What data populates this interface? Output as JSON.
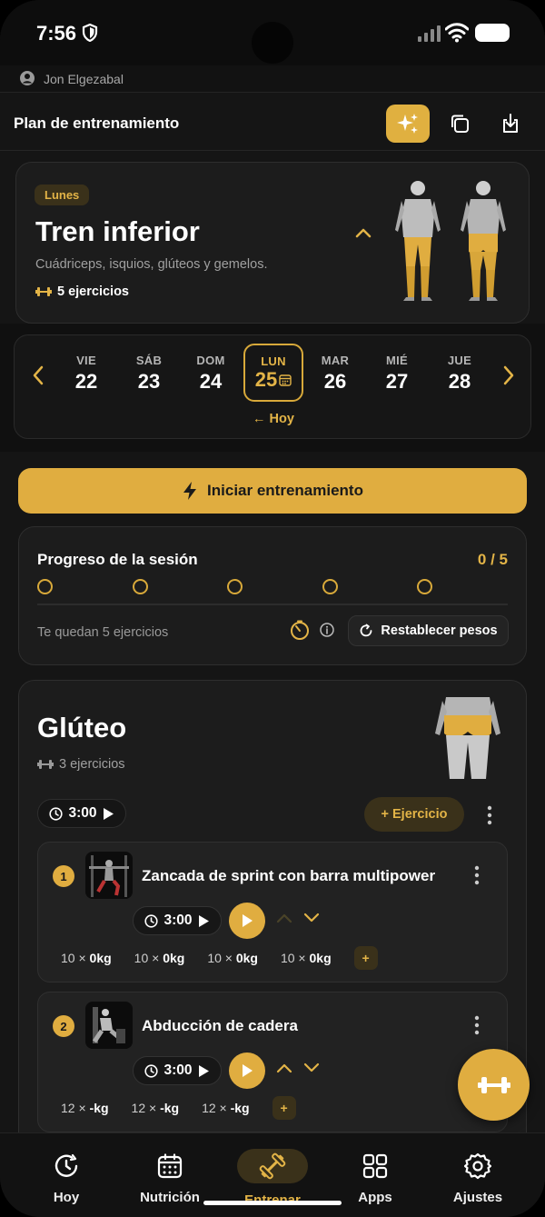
{
  "status": {
    "time": "7:56"
  },
  "user": {
    "name": "Jon Elgezabal"
  },
  "header": {
    "title": "Plan de entrenamiento"
  },
  "day_card": {
    "pill": "Lunes",
    "title": "Tren inferior",
    "subtitle": "Cuádriceps, isquios, glúteos y gemelos.",
    "exercise_count": "5 ejercicios"
  },
  "week": {
    "days": [
      {
        "name": "VIE",
        "date": "22"
      },
      {
        "name": "SÁB",
        "date": "23"
      },
      {
        "name": "DOM",
        "date": "24"
      },
      {
        "name": "LUN",
        "date": "25"
      },
      {
        "name": "MAR",
        "date": "26"
      },
      {
        "name": "MIÉ",
        "date": "27"
      },
      {
        "name": "JUE",
        "date": "28"
      }
    ],
    "today_label": "← Hoy"
  },
  "start_button": {
    "label": "Iniciar entrenamiento"
  },
  "progress": {
    "title": "Progreso de la sesión",
    "count": "0 / 5",
    "completed": 0,
    "total": 5,
    "remaining": "Te quedan 5 ejercicios",
    "reset_label": "Restablecer pesos"
  },
  "group": {
    "title": "Glúteo",
    "count": "3 ejercicios",
    "timer": "3:00",
    "add_label": "+ Ejercicio",
    "exercises": [
      {
        "num": "1",
        "name": "Zancada de sprint con barra multipower",
        "timer": "3:00",
        "sets": [
          {
            "reps": "10 ×",
            "weight": "0kg"
          },
          {
            "reps": "10 ×",
            "weight": "0kg"
          },
          {
            "reps": "10 ×",
            "weight": "0kg"
          },
          {
            "reps": "10 ×",
            "weight": "0kg"
          }
        ]
      },
      {
        "num": "2",
        "name": "Abducción de cadera",
        "timer": "3:00",
        "sets": [
          {
            "reps": "12 ×",
            "weight": "-kg"
          },
          {
            "reps": "12 ×",
            "weight": "-kg"
          },
          {
            "reps": "12 ×",
            "weight": "-kg"
          }
        ]
      }
    ],
    "add_set": "+"
  },
  "tabs": [
    {
      "label": "Hoy",
      "icon": "clock-icon"
    },
    {
      "label": "Nutrición",
      "icon": "calendar-icon"
    },
    {
      "label": "Entrenar",
      "icon": "dumbbell-icon",
      "active": true
    },
    {
      "label": "Apps",
      "icon": "grid-icon"
    },
    {
      "label": "Ajustes",
      "icon": "gear-icon"
    }
  ],
  "colors": {
    "accent": "#e0ad40",
    "accent_dark": "#3a311a",
    "background": "#151515",
    "card": "#1c1c1c"
  }
}
